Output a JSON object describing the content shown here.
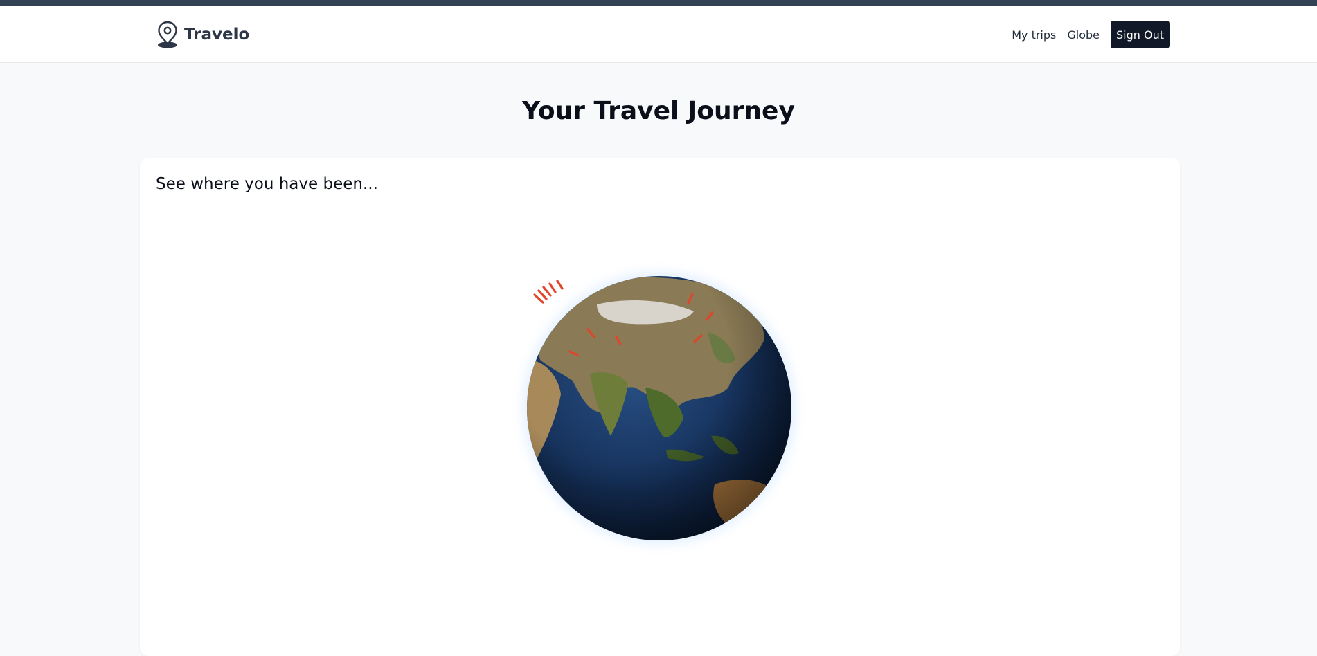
{
  "app": {
    "brand_name": "Travelo"
  },
  "nav": {
    "links": [
      {
        "label": "My trips"
      },
      {
        "label": "Globe"
      }
    ],
    "sign_out_label": "Sign Out"
  },
  "page": {
    "title": "Your Travel Journey",
    "card_title": "See where you have been..."
  },
  "globe": {
    "icon": "earth-globe",
    "marker_color": "#e0452b",
    "ocean_color": "#16325c",
    "atmosphere_color": "#bfdcff"
  },
  "colors": {
    "topbar": "#334155",
    "sign_out_bg": "#111827",
    "brand_text": "#2d3748"
  }
}
